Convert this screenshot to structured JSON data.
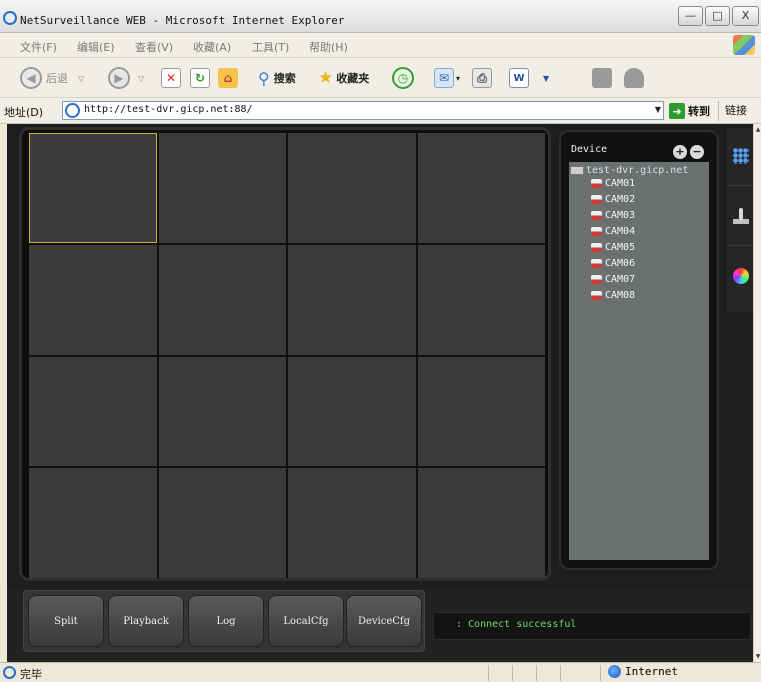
{
  "window": {
    "title": "NetSurveillance WEB - Microsoft Internet Explorer",
    "min_label": "—",
    "max_label": "□",
    "close_label": "X"
  },
  "menu": [
    "文件(F)",
    "编辑(E)",
    "查看(V)",
    "收藏(A)",
    "工具(T)",
    "帮助(H)"
  ],
  "toolbar": {
    "back_label": "后退",
    "search_label": "搜索",
    "favorites_label": "收藏夹"
  },
  "address": {
    "label": "地址(D)",
    "url": "http://test-dvr.gicp.net:88/",
    "go_label": "转到",
    "links_label": "链接"
  },
  "device_panel": {
    "header": "Device",
    "root": "test-dvr.gicp.net",
    "cameras": [
      "CAM01",
      "CAM02",
      "CAM03",
      "CAM04",
      "CAM05",
      "CAM06",
      "CAM07",
      "CAM08"
    ]
  },
  "video_grid": {
    "rows": 4,
    "cols": 4,
    "selected_index": 0
  },
  "buttons": [
    "Split",
    "Playback",
    "Log",
    "LocalCfg",
    "DeviceCfg"
  ],
  "status_message": ":  Connect successful",
  "statusbar": {
    "text": "完毕",
    "zone": "Internet"
  },
  "colors": {
    "selected_cell": "#c8b13a",
    "status_text": "#6fd86a",
    "cell_bg": "#3b3b3b"
  }
}
